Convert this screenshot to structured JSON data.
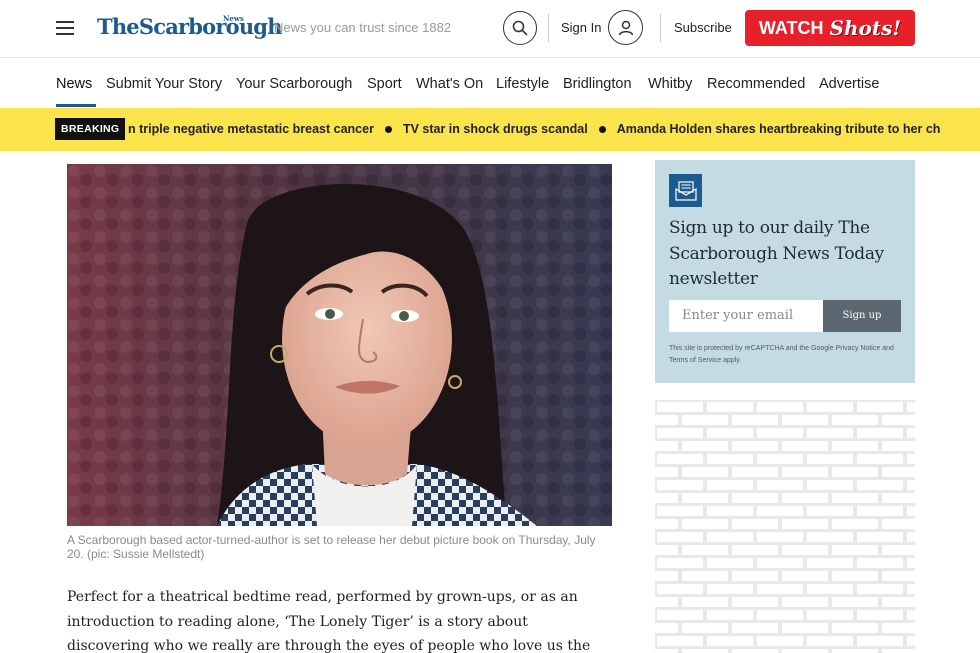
{
  "header": {
    "logo": "TheScarborough",
    "logo_news": "News",
    "tagline": "News you can trust since 1882",
    "sign_in": "Sign In",
    "subscribe": "Subscribe",
    "watch_label": "WATCH",
    "watch_brand": "Shots!",
    "brand_color": "#1d5a8e",
    "watch_color": "#e8202a"
  },
  "nav": {
    "items": [
      {
        "label": "News"
      },
      {
        "label": "Submit Your Story"
      },
      {
        "label": "Your Scarborough"
      },
      {
        "label": "Sport"
      },
      {
        "label": "What's On"
      },
      {
        "label": "Lifestyle"
      },
      {
        "label": "Bridlington"
      },
      {
        "label": "Whitby"
      },
      {
        "label": "Recommended"
      },
      {
        "label": "Advertise"
      }
    ],
    "active": "News"
  },
  "breaking": {
    "badge": "BREAKING",
    "items": [
      "n triple negative metastatic breast cancer",
      "TV star in shock drugs scandal",
      "Amanda Holden shares heartbreaking tribute to her ch"
    ],
    "bar_color": "#fbe34c"
  },
  "article": {
    "caption": "A Scarborough based actor-turned-author is set to release her debut picture book on Thursday, July 20. (pic: Sussie Mellstedt)",
    "paragraph": "Perfect for a theatrical bedtime read, performed by grown-ups, or as an introduction to reading alone, ‘The Lonely Tiger’ is a story about discovering who we really are through the eyes of people who love us the most."
  },
  "newsletter": {
    "title": "Sign up to our daily The Scarborough News Today newsletter",
    "email_placeholder": "Enter your email",
    "button": "Sign up",
    "legal": "This site is protected by reCAPTCHA and the Google Privacy Notice and Terms of Service apply.",
    "bg_color": "#c5dbe4"
  }
}
